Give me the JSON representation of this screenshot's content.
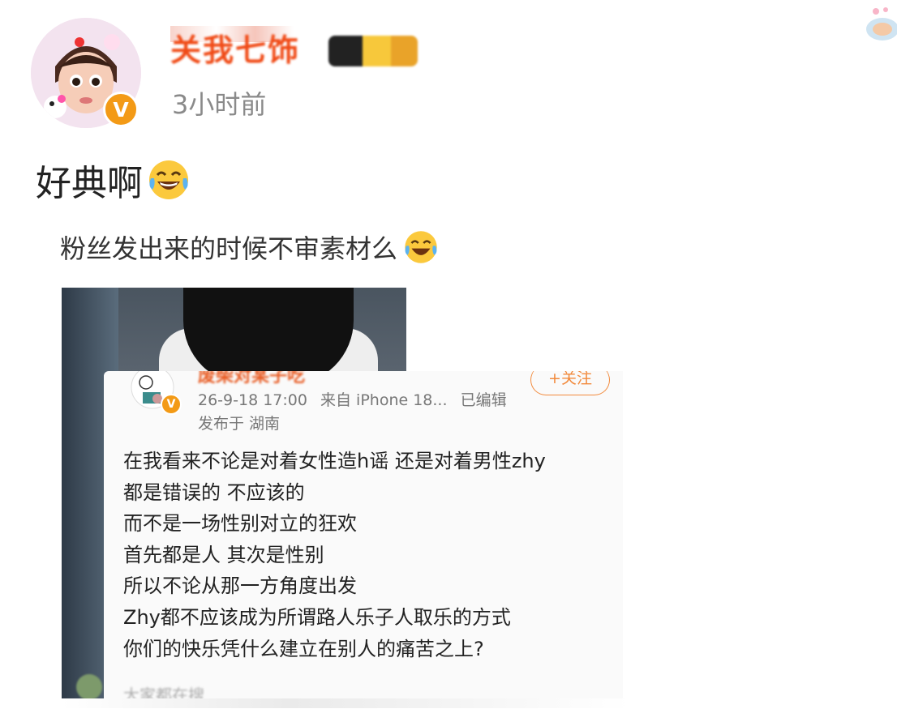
{
  "post": {
    "username": "关我七饰",
    "timestamp": "3小时前",
    "text": "好典啊",
    "verified_mark": "V"
  },
  "embedded": {
    "caption": "粉丝发出来的时候不审素材么",
    "card": {
      "username": "废柴对某子吃",
      "date": "26-9-18 17:00",
      "source": "来自 iPhone 18...",
      "edited": "已编辑",
      "location": "发布于 湖南",
      "follow_label": "+关注",
      "body_lines": [
        "在我看来不论是对着女性造h谣 还是对着男性zhy",
        "都是错误的 不应该的",
        "而不是一场性别对立的狂欢",
        "首先都是人 其次是性别",
        "所以不论从那一方角度出发",
        "Zhy都不应该成为所谓路人乐子人取乐的方式",
        "你们的快乐凭什么建立在别人的痛苦之上?"
      ],
      "footer": "大家都在搜"
    }
  },
  "colors": {
    "username": "#f04a16",
    "verified": "#f39a16",
    "follow": "#f28a3c"
  },
  "icons": [
    "avatar-icon",
    "verified-icon",
    "level-badge-icon",
    "laugh-cry-emoji",
    "sticker-icon"
  ]
}
